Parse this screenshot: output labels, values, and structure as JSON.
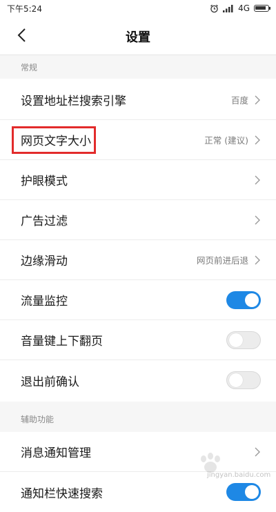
{
  "status_bar": {
    "time": "下午5:24",
    "network": "4G",
    "battery_level": 0.9
  },
  "header": {
    "back_icon": "chevron-left-icon",
    "title": "设置"
  },
  "sections": [
    {
      "title": "常规",
      "rows": [
        {
          "label": "设置地址栏搜索引擎",
          "value": "百度",
          "control": "chevron"
        },
        {
          "label": "网页文字大小",
          "value": "正常 (建议)",
          "control": "chevron",
          "highlighted": true
        },
        {
          "label": "护眼模式",
          "value": "",
          "control": "chevron"
        },
        {
          "label": "广告过滤",
          "value": "",
          "control": "chevron"
        },
        {
          "label": "边缘滑动",
          "value": "网页前进后退",
          "control": "chevron"
        },
        {
          "label": "流量监控",
          "value": "",
          "control": "toggle",
          "state": true
        },
        {
          "label": "音量键上下翻页",
          "value": "",
          "control": "toggle",
          "state": false
        },
        {
          "label": "退出前确认",
          "value": "",
          "control": "toggle",
          "state": false
        }
      ]
    },
    {
      "title": "辅助功能",
      "rows": [
        {
          "label": "消息通知管理",
          "value": "",
          "control": "chevron"
        },
        {
          "label": "通知栏快速搜索",
          "value": "",
          "control": "toggle",
          "state": true
        }
      ]
    }
  ],
  "colors": {
    "accent": "#1e88e5",
    "highlight_box": "#e22b2b"
  },
  "watermark": {
    "text": "jingyan.baidu.com"
  }
}
